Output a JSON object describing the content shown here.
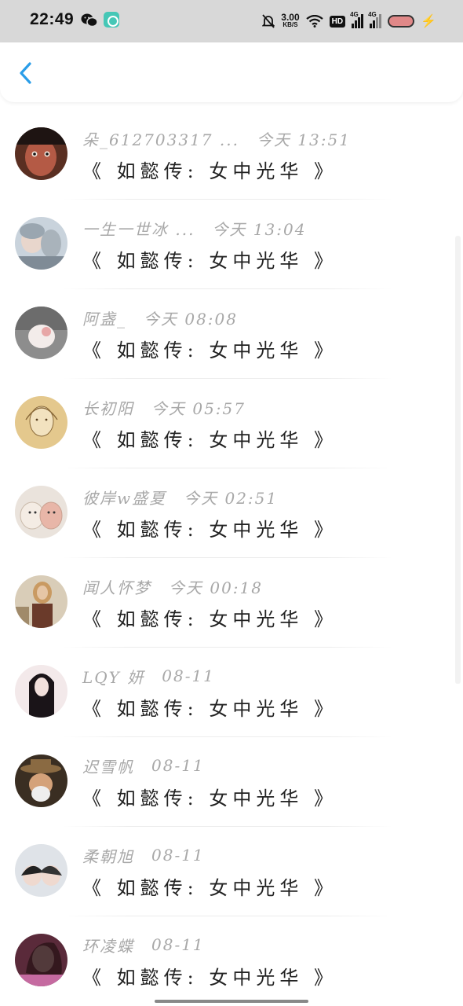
{
  "status_bar": {
    "time": "22:49",
    "net_speed_value": "3.00",
    "net_speed_unit": "KB/S",
    "hd_badge": "HD",
    "signal_1_label": "4G",
    "signal_2_label": "4G",
    "charging_color": "#2bb34a"
  },
  "nav": {
    "back_icon": "chevron-left-icon",
    "accent_color": "#2a9de8"
  },
  "messages": [
    {
      "name": "朵_612703317 ...",
      "time": "今天 13:51",
      "text": "《 如懿传: 女中光华 》"
    },
    {
      "name": "一生一世冰 ...",
      "time": "今天 13:04",
      "text": "《 如懿传: 女中光华 》"
    },
    {
      "name": "阿盏_",
      "time": "今天 08:08",
      "text": "《 如懿传: 女中光华 》"
    },
    {
      "name": "长初阳",
      "time": "今天 05:57",
      "text": "《 如懿传: 女中光华 》"
    },
    {
      "name": "彼岸w盛夏",
      "time": "今天 02:51",
      "text": "《 如懿传: 女中光华 》"
    },
    {
      "name": "闻人怀梦",
      "time": "今天 00:18",
      "text": "《 如懿传: 女中光华 》"
    },
    {
      "name": "LQY 妍",
      "time": "08-11",
      "text": "《 如懿传: 女中光华 》"
    },
    {
      "name": "迟雪帆",
      "time": "08-11",
      "text": "《 如懿传: 女中光华 》"
    },
    {
      "name": "柔朝旭",
      "time": "08-11",
      "text": "《 如懿传: 女中光华 》"
    },
    {
      "name": "环凌蝶",
      "time": "08-11",
      "text": "《 如懿传: 女中光华 》"
    }
  ]
}
